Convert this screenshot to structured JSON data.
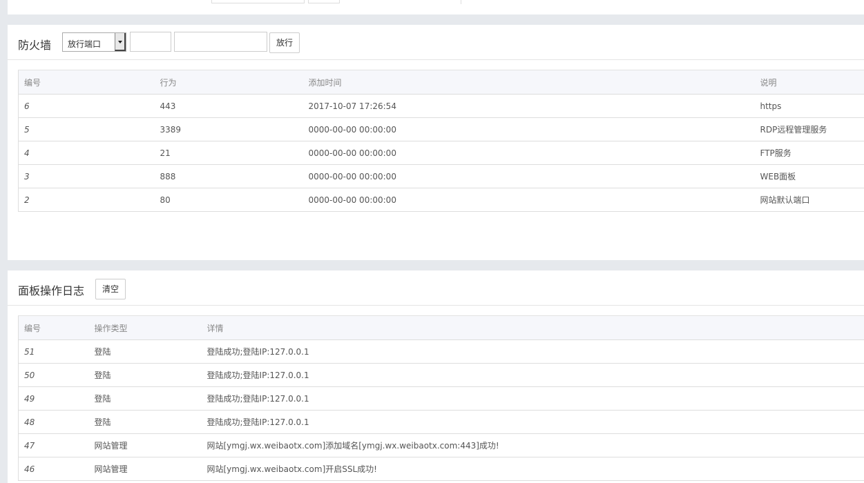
{
  "firewall": {
    "title": "防火墙",
    "select_value": "放行端口",
    "port_placeholder": "",
    "desc_placeholder": "",
    "allow_button": "放行",
    "columns": [
      "编号",
      "行为",
      "添加时间",
      "说明"
    ],
    "rows": [
      {
        "id": "6",
        "action": "443",
        "time": "2017-10-07 17:26:54",
        "desc": "https"
      },
      {
        "id": "5",
        "action": "3389",
        "time": "0000-00-00 00:00:00",
        "desc": "RDP远程管理服务"
      },
      {
        "id": "4",
        "action": "21",
        "time": "0000-00-00 00:00:00",
        "desc": "FTP服务"
      },
      {
        "id": "3",
        "action": "888",
        "time": "0000-00-00 00:00:00",
        "desc": "WEB面板"
      },
      {
        "id": "2",
        "action": "80",
        "time": "0000-00-00 00:00:00",
        "desc": "网站默认端口"
      }
    ]
  },
  "logs": {
    "title": "面板操作日志",
    "clear_button": "清空",
    "columns": [
      "编号",
      "操作类型",
      "详情"
    ],
    "rows": [
      {
        "id": "51",
        "type": "登陆",
        "detail": "登陆成功;登陆IP:127.0.0.1"
      },
      {
        "id": "50",
        "type": "登陆",
        "detail": "登陆成功;登陆IP:127.0.0.1"
      },
      {
        "id": "49",
        "type": "登陆",
        "detail": "登陆成功;登陆IP:127.0.0.1"
      },
      {
        "id": "48",
        "type": "登陆",
        "detail": "登陆成功;登陆IP:127.0.0.1"
      },
      {
        "id": "47",
        "type": "网站管理",
        "detail": "网站[ymgj.wx.weibaotx.com]添加域名[ymgj.wx.weibaotx.com:443]成功!"
      },
      {
        "id": "46",
        "type": "网站管理",
        "detail": "网站[ymgj.wx.weibaotx.com]开启SSL成功!"
      }
    ]
  }
}
